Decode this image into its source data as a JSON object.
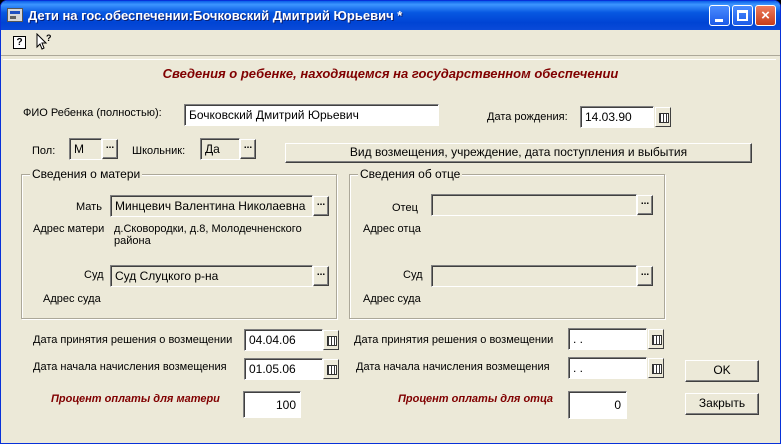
{
  "window": {
    "title": "Дети на гос.обеспечении:Бочковский Дмитрий Юрьевич *",
    "minimize": "",
    "maximize": "",
    "close": "×"
  },
  "toolbar": {
    "help_glyph": "?"
  },
  "heading": "Сведения о ребенке, находящемся на государственном обеспечении",
  "child": {
    "fio_label": "ФИО Ребенка (полностью):",
    "fio_value": "Бочковский Дмитрий Юрьевич",
    "dob_label": "Дата рождения:",
    "dob_value": "14.03.90",
    "sex_label": "Пол:",
    "sex_value": "М",
    "schoolchild_label": "Школьник:",
    "schoolchild_value": "Да",
    "compensation_button": "Вид возмещения, учреждение, дата поступления и выбытия"
  },
  "mother": {
    "group_title": "Сведения о матери",
    "name_label": "Мать",
    "name_value": "Минцевич Валентина Николаевна",
    "address_label": "Адрес матери",
    "address_value": "д.Сковородки, д.8, Молодечненского района",
    "court_label": "Суд",
    "court_value": "Суд Слуцкого р-на",
    "court_address_label": "Адрес суда",
    "decision_date_label": "Дата принятия решения о возмещении",
    "decision_date_value": "04.04.06",
    "accrual_date_label": "Дата начала начисления возмещения",
    "accrual_date_value": "01.05.06",
    "percent_label": "Процент оплаты для матери",
    "percent_value": "100"
  },
  "father": {
    "group_title": "Сведения об отце",
    "name_label": "Отец",
    "name_value": "",
    "address_label": "Адрес отца",
    "court_label": "Суд",
    "court_value": "",
    "court_address_label": "Адрес суда",
    "decision_date_label": "Дата принятия решения о возмещении",
    "decision_date_value": " .  . ",
    "accrual_date_label": "Дата начала начисления возмещения",
    "accrual_date_value": " .  . ",
    "percent_label": "Процент оплаты для отца",
    "percent_value": "0"
  },
  "buttons": {
    "ok": "OK",
    "close": "Закрыть",
    "ellipsis": "..."
  },
  "colors": {
    "titlebar": "#0a5fe8",
    "dialog_bg": "#ece9d8",
    "accent_label": "#800000"
  }
}
